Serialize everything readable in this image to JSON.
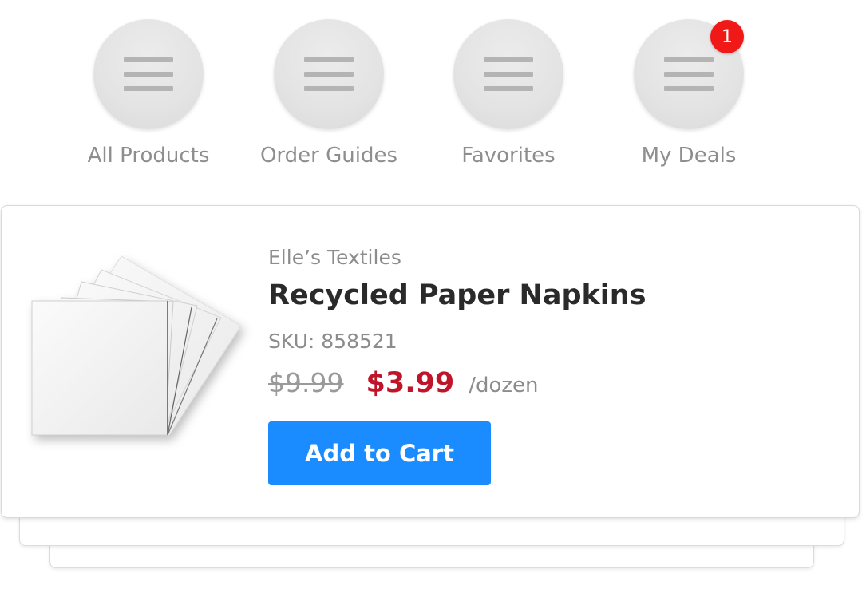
{
  "categories": [
    {
      "label": "All Products",
      "icon": "menu-icon"
    },
    {
      "label": "Order Guides",
      "icon": "menu-icon"
    },
    {
      "label": "Favorites",
      "icon": "menu-icon"
    },
    {
      "label": "My Deals",
      "icon": "menu-icon",
      "badge": "1"
    }
  ],
  "product": {
    "brand": "Elle’s Textiles",
    "name": "Recycled Paper Napkins",
    "sku": "SKU: 858521",
    "original_price": "$9.99",
    "sale_price": "$3.99",
    "unit": "/dozen",
    "image": "paper-napkins-image",
    "add_to_cart_label": "Add to Cart"
  },
  "colors": {
    "accent": "#1a8cff",
    "sale": "#c0142a",
    "badge": "#f11818"
  }
}
